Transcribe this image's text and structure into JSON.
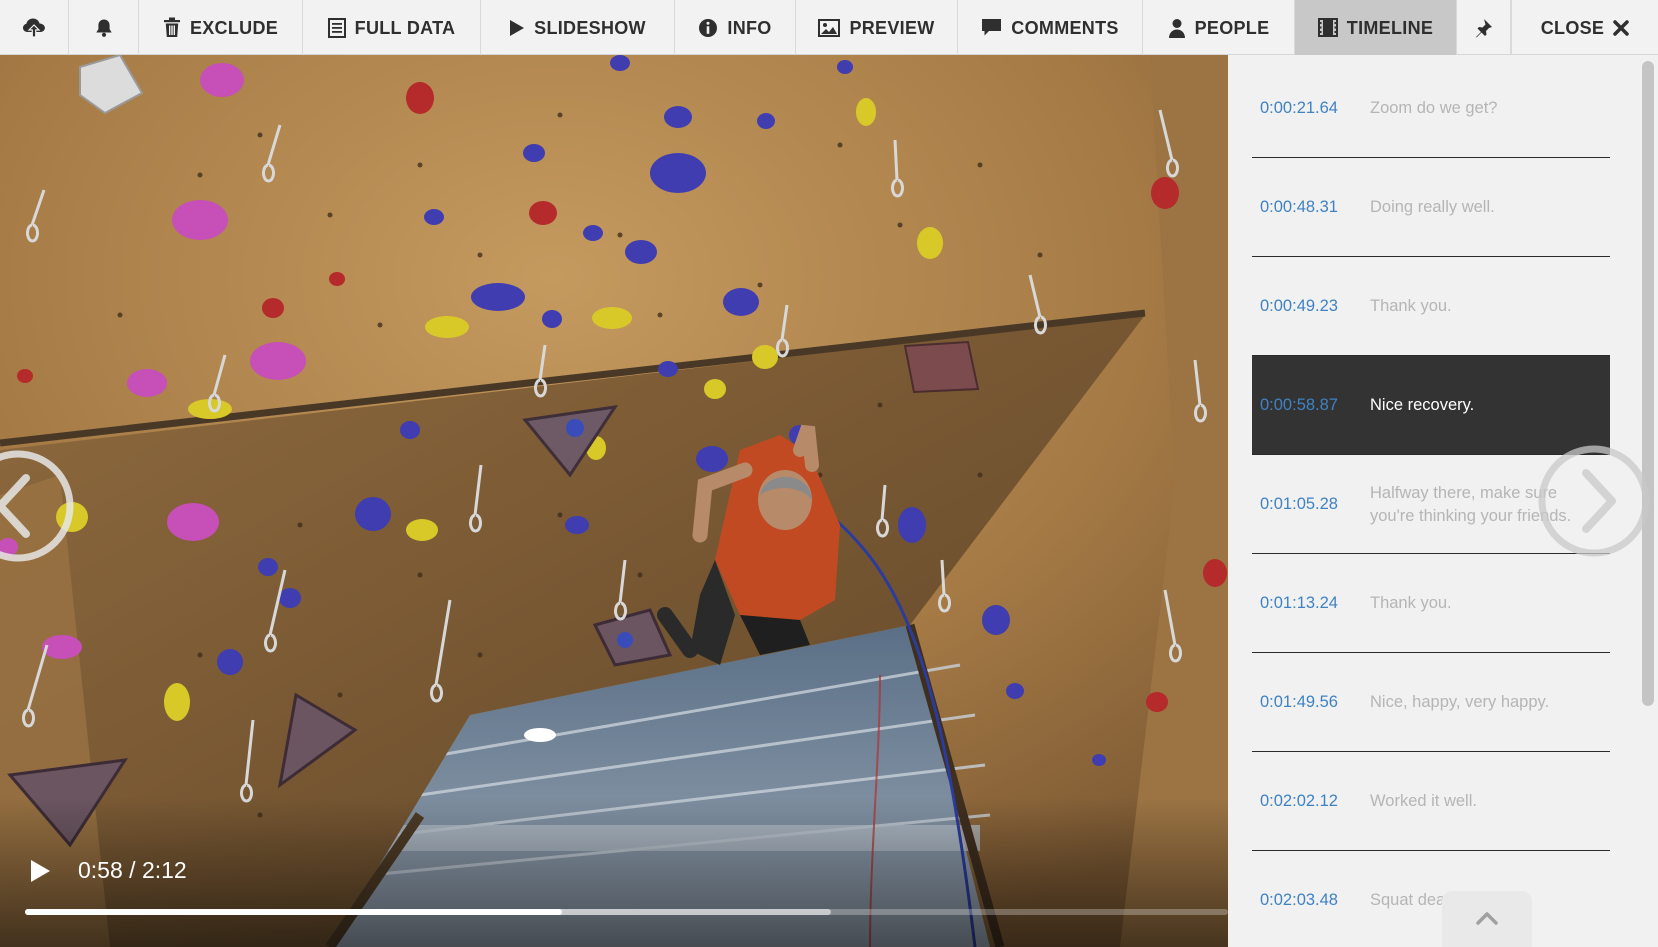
{
  "toolbar": {
    "items": [
      {
        "id": "upload",
        "icon": "upload-cloud-icon",
        "label": ""
      },
      {
        "id": "notify",
        "icon": "bell-icon",
        "label": ""
      },
      {
        "id": "exclude",
        "icon": "trash-icon",
        "label": "EXCLUDE"
      },
      {
        "id": "full-data",
        "icon": "document-icon",
        "label": "FULL DATA"
      },
      {
        "id": "slideshow",
        "icon": "play-icon",
        "label": "SLIDESHOW"
      },
      {
        "id": "info",
        "icon": "info-icon",
        "label": "INFO"
      },
      {
        "id": "preview",
        "icon": "image-icon",
        "label": "PREVIEW"
      },
      {
        "id": "comments",
        "icon": "comment-icon",
        "label": "COMMENTS"
      },
      {
        "id": "people",
        "icon": "person-icon",
        "label": "PEOPLE"
      },
      {
        "id": "timeline",
        "icon": "film-icon",
        "label": "TIMELINE",
        "active": true
      },
      {
        "id": "pin",
        "icon": "pin-icon",
        "label": ""
      },
      {
        "id": "close",
        "icon": "close-icon",
        "label": "CLOSE"
      }
    ]
  },
  "player": {
    "current_time": "0:58",
    "separator": "/",
    "duration": "2:12",
    "progress_fraction": 0.446,
    "buffered_fraction": 0.67
  },
  "timeline": {
    "entries": [
      {
        "time": "0:00:21.64",
        "text": "Zoom do we get?"
      },
      {
        "time": "0:00:48.31",
        "text": "Doing really well."
      },
      {
        "time": "0:00:49.23",
        "text": "Thank you."
      },
      {
        "time": "0:00:58.87",
        "text": "Nice recovery.",
        "active": true
      },
      {
        "time": "0:01:05.28",
        "text": "Halfway there, make sure you're thinking your friends."
      },
      {
        "time": "0:01:13.24",
        "text": "Thank you."
      },
      {
        "time": "0:01:49.56",
        "text": "Nice, happy, very happy."
      },
      {
        "time": "0:02:02.12",
        "text": "Worked it well."
      },
      {
        "time": "0:02:03.48",
        "text": "Squat dead."
      }
    ]
  },
  "colors": {
    "toolbar_bg": "#f2f2f2",
    "toolbar_active": "#c8c8c8",
    "timestamp": "#3f82c4",
    "active_row": "#333333",
    "caption": "#b5b5b5"
  }
}
